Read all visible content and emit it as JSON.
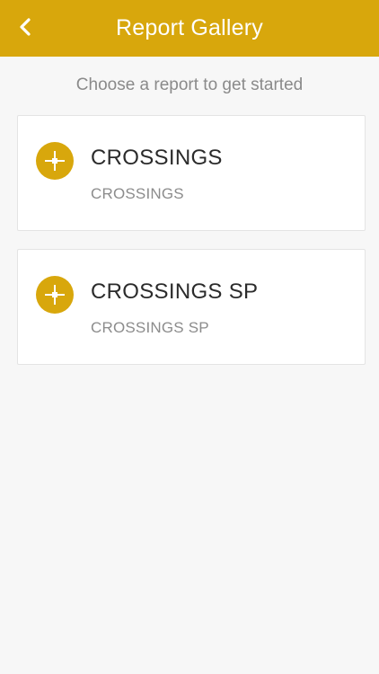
{
  "header": {
    "title": "Report Gallery",
    "back_icon": "chevron-left-icon",
    "color": "#d8a70c"
  },
  "subtitle": "Choose a report to get started",
  "reports": [
    {
      "title": "CROSSINGS",
      "subtitle": "CROSSINGS",
      "icon": "crosshair-icon"
    },
    {
      "title": "CROSSINGS SP",
      "subtitle": "CROSSINGS SP",
      "icon": "crosshair-icon"
    }
  ],
  "colors": {
    "accent": "#d8a70c",
    "background": "#f7f7f7",
    "card": "#ffffff",
    "title_text": "#2b2b2b",
    "muted_text": "#8c8c8c"
  }
}
